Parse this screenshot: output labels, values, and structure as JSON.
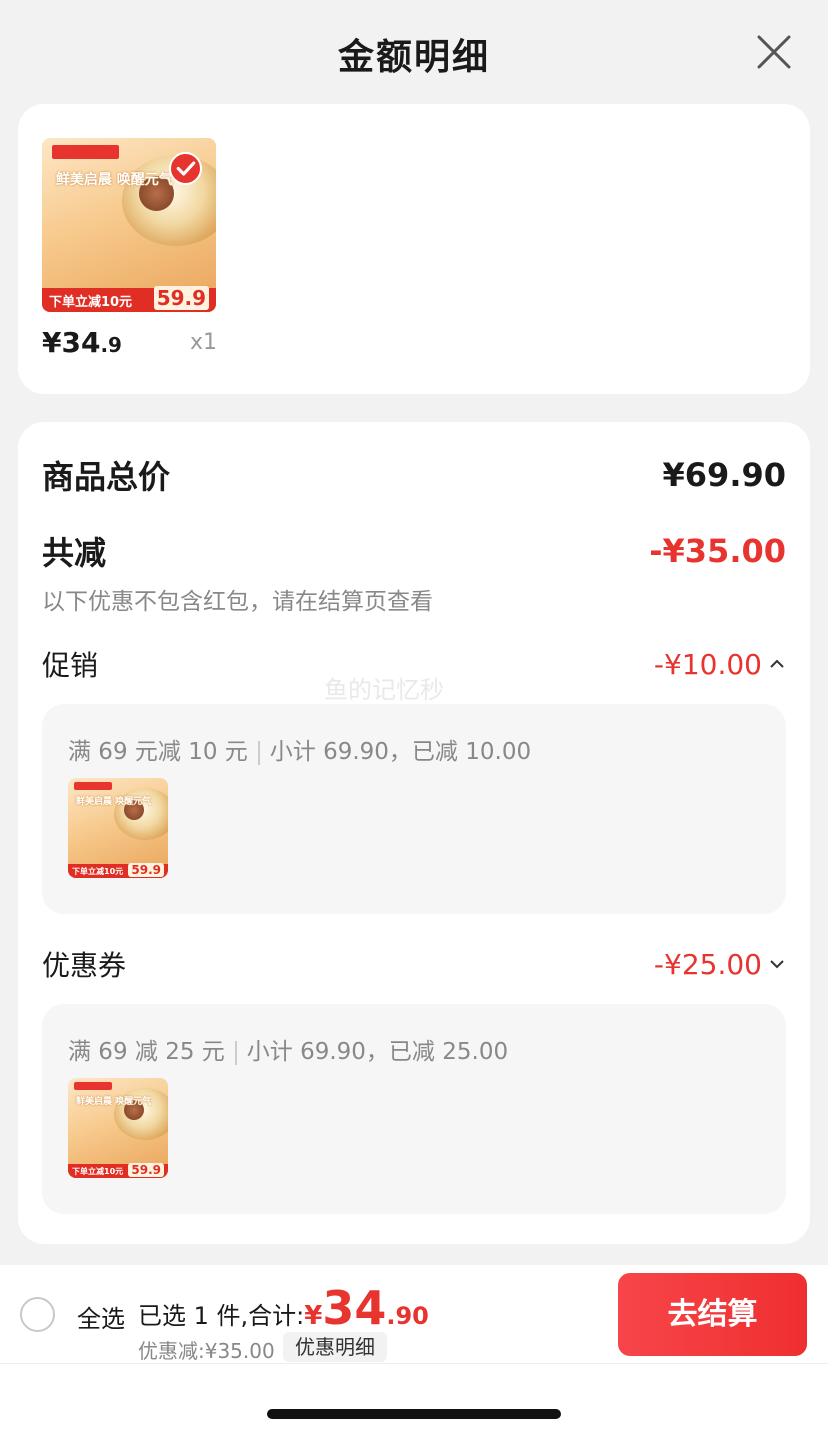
{
  "header": {
    "title": "金额明细"
  },
  "product": {
    "price_main": "¥34",
    "price_dec": ".9",
    "qty": "x1",
    "image": {
      "slogan": "鲜美启晨 唤醒元气",
      "banner": "下单立减10元",
      "price": "59.9",
      "brand_color": "#e8342f"
    }
  },
  "summary": {
    "total_label": "商品总价",
    "total_value": "¥69.90",
    "reduce_label": "共减",
    "reduce_value": "-¥35.00",
    "note": "以下优惠不包含红包，请在结算页查看",
    "promo": {
      "label": "促销",
      "value": "-¥10.00",
      "rule": "满 69 元减 10 元",
      "detail": "小计 69.90，已减 10.00",
      "expanded": true
    },
    "coupon": {
      "label": "优惠券",
      "value": "-¥25.00",
      "rule": "满 69 减 25 元",
      "detail": "小计 69.90，已减 25.00",
      "expanded": false
    }
  },
  "watermark": "鱼的记忆秒",
  "footer": {
    "select_all": "全选",
    "selected_text": "已选 1 件,合计:",
    "yen": "¥",
    "total_int": "34",
    "total_dec": ".90",
    "discount": "优惠减:¥35.00",
    "detail_button": "优惠明细",
    "checkout_button": "去结算"
  },
  "colors": {
    "accent": "#e8342f",
    "background": "#f2f2f2"
  }
}
